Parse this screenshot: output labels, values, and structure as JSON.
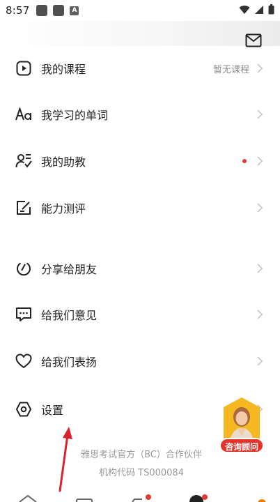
{
  "status_bar": {
    "time": "8:57",
    "notification_badge": "A"
  },
  "menu": {
    "items": [
      {
        "label": "我的课程",
        "hint": "暂无课程",
        "icon": "play-icon",
        "dot": false
      },
      {
        "label": "我学习的单词",
        "hint": "",
        "icon": "aa-font-icon",
        "dot": false
      },
      {
        "label": "我的助教",
        "hint": "",
        "icon": "assistant-icon",
        "dot": true
      },
      {
        "label": "能力测评",
        "hint": "",
        "icon": "edit-box-icon",
        "dot": false
      },
      {
        "label": "分享给朋友",
        "hint": "",
        "icon": "share-icon",
        "dot": false
      },
      {
        "label": "给我们意见",
        "hint": "",
        "icon": "chat-bubble-icon",
        "dot": false
      },
      {
        "label": "给我们表扬",
        "hint": "",
        "icon": "heart-icon",
        "dot": false
      },
      {
        "label": "设置",
        "hint": "",
        "icon": "settings-hex-icon",
        "dot": false
      }
    ]
  },
  "footer": {
    "line1": "雅思考试官方（BC）合作伙伴",
    "line2": "机构代码 TS000084"
  },
  "consult": {
    "label": "咨询顾问"
  },
  "colors": {
    "accent_red": "#e53935",
    "badge_yellow": "#f5b820"
  }
}
